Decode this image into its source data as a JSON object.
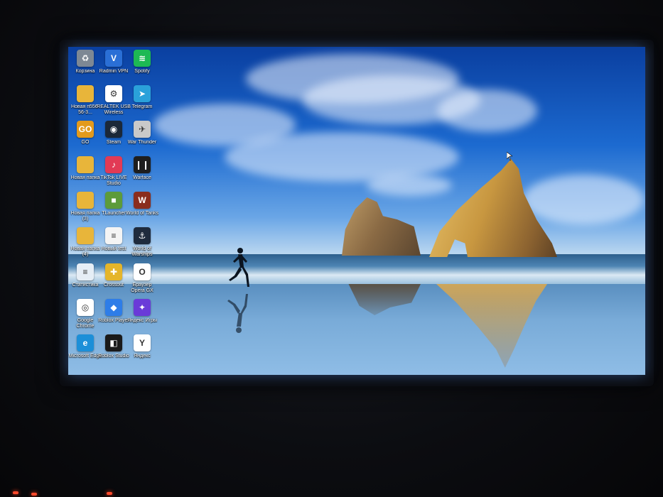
{
  "desktop": {
    "icons": [
      {
        "label": "Корзина",
        "icon": "recycle-bin-icon",
        "color": "#7d8894",
        "glyph": "♻"
      },
      {
        "label": "Radmin VPN",
        "icon": "radmin-vpn-icon",
        "color": "#2a6fd6",
        "glyph": "V"
      },
      {
        "label": "Spotify",
        "icon": "spotify-icon",
        "color": "#1db954",
        "glyph": "≋"
      },
      {
        "label": "Новая п556-56-3...",
        "icon": "folder-icon",
        "color": "#e8b53a",
        "glyph": ""
      },
      {
        "label": "REALTEK USB Wireless LAN...",
        "icon": "realtek-icon",
        "color": "#ffffff",
        "glyph": "⚙"
      },
      {
        "label": "Telegram",
        "icon": "telegram-icon",
        "color": "#2aa1da",
        "glyph": "➤"
      },
      {
        "label": "GO",
        "icon": "csgo-icon",
        "color": "#e39a1c",
        "glyph": "GO"
      },
      {
        "label": "Steam",
        "icon": "steam-icon",
        "color": "#1b2838",
        "glyph": "◉"
      },
      {
        "label": "War Thunder",
        "icon": "war-thunder-icon",
        "color": "#c9c9c9",
        "glyph": "✈"
      },
      {
        "label": "Новая папка",
        "icon": "folder-icon",
        "color": "#e8b53a",
        "glyph": ""
      },
      {
        "label": "TikTok LIVE Studio",
        "icon": "tiktok-live-studio-icon",
        "color": "#e23a55",
        "glyph": "♪"
      },
      {
        "label": "Warface",
        "icon": "warface-icon",
        "color": "#1e1e1e",
        "glyph": "❙❙"
      },
      {
        "label": "Новая папка (3)",
        "icon": "folder-icon",
        "color": "#e8b53a",
        "glyph": ""
      },
      {
        "label": "TLauncher",
        "icon": "tlauncher-icon",
        "color": "#5d9b3a",
        "glyph": "■"
      },
      {
        "label": "World of Tanks",
        "icon": "world-of-tanks-icon",
        "color": "#8a2d1e",
        "glyph": "W"
      },
      {
        "label": "Новая папка (4)",
        "icon": "folder-icon",
        "color": "#e8b53a",
        "glyph": ""
      },
      {
        "label": "Новый test",
        "icon": "text-file-icon",
        "color": "#f4f4f4",
        "glyph": "≡"
      },
      {
        "label": "World of Warships",
        "icon": "world-of-warships-icon",
        "color": "#1f2b3d",
        "glyph": "⚓"
      },
      {
        "label": "Статистика",
        "icon": "document-icon",
        "color": "#e6eef6",
        "glyph": "≡"
      },
      {
        "label": "Crossout",
        "icon": "crossout-icon",
        "color": "#e5b52a",
        "glyph": "✚"
      },
      {
        "label": "Браузер Opera GX",
        "icon": "opera-gx-icon",
        "color": "#ffffff",
        "glyph": "O"
      },
      {
        "label": "Google Chrome",
        "icon": "google-chrome-icon",
        "color": "#ffffff",
        "glyph": "◎"
      },
      {
        "label": "Roblox Player",
        "icon": "roblox-player-icon",
        "color": "#2e7de8",
        "glyph": "◆"
      },
      {
        "label": "Яндекс Игры",
        "icon": "yandex-games-icon",
        "color": "#6a3bd8",
        "glyph": "✦"
      },
      {
        "label": "Microsoft Edge",
        "icon": "microsoft-edge-icon",
        "color": "#1c8fd8",
        "glyph": "e"
      },
      {
        "label": "Roblox Studio",
        "icon": "roblox-studio-icon",
        "color": "#1a1a1a",
        "glyph": "◧"
      },
      {
        "label": "Яндекс",
        "icon": "yandex-browser-icon",
        "color": "#ffffff",
        "glyph": "Y"
      }
    ]
  }
}
